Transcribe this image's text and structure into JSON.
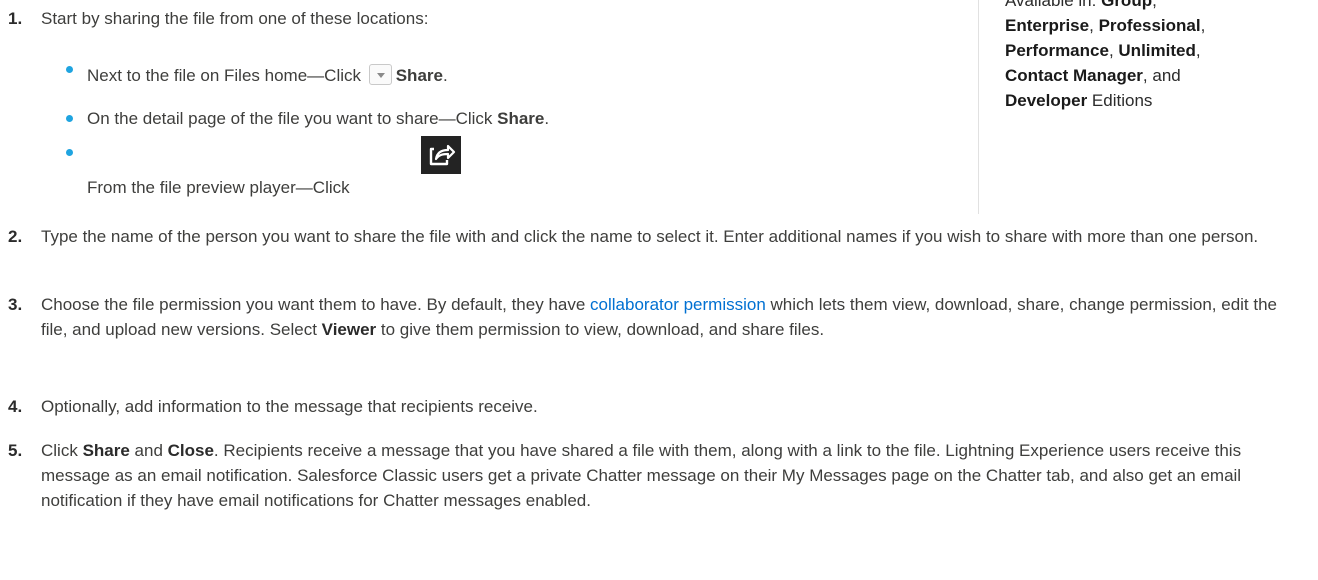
{
  "steps": [
    {
      "num": "1.",
      "text": "Start by sharing the file from one of these locations:"
    },
    {
      "num": "2.",
      "text": "Type the name of the person you want to share the file with and click the name to select it. Enter additional names if you wish to share with more than one person."
    },
    {
      "num": "3.",
      "text_a": "Choose the file permission you want them to have. By default, they have ",
      "link": "collaborator permission",
      "text_b": " which lets them view, download, share, change permission, edit the file, and upload new versions. Select ",
      "bold": "Viewer",
      "text_c": " to give them permission to view, download, and share files."
    },
    {
      "num": "4.",
      "text": "Optionally, add information to the message that recipients receive."
    },
    {
      "num": "5.",
      "text_a": "Click ",
      "bold_a": "Share",
      "text_b": " and ",
      "bold_b": "Close",
      "text_c": ". Recipients receive a message that you have shared a file with them, along with a link to the file. Lightning Experience users receive this message as an email notification. Salesforce Classic users get a private Chatter message on their My Messages page on the Chatter tab, and also get an email notification if they have email notifications for Chatter messages enabled."
    }
  ],
  "bullets": [
    {
      "text_a": "Next to the file on Files home—Click ",
      "bold": "Share",
      "text_b": "."
    },
    {
      "text_a": "On the detail page of the file you want to share—Click ",
      "bold": "Share",
      "text_b": "."
    },
    {
      "text_a": "From the file preview player—Click "
    }
  ],
  "icons": {
    "dropdown": "dropdown-arrow-icon",
    "share": "share-icon"
  },
  "sidebar": {
    "prefix": "Available in: ",
    "group": "Group",
    "enterprise": "Enterprise",
    "professional": "Professional",
    "performance": "Performance",
    "unlimited": "Unlimited",
    "contact_manager": "Contact Manager",
    "and": ", and",
    "developer": "Developer",
    "editions": " Editions",
    "comma": ","
  },
  "colors": {
    "link": "#0070d2",
    "bullet": "#1fa4e0",
    "text": "#3e3e3c"
  }
}
